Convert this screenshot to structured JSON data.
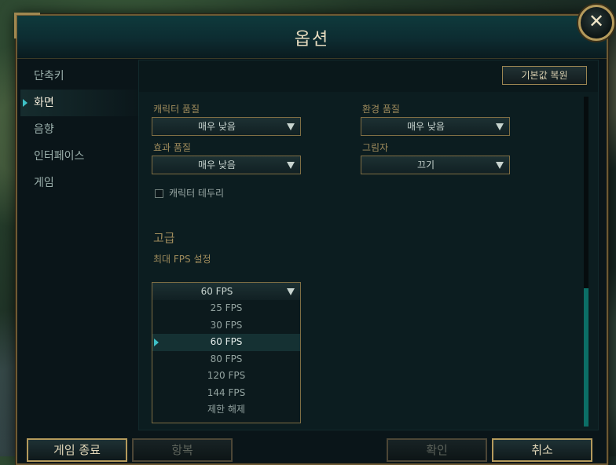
{
  "window": {
    "title": "옵션"
  },
  "sidebar": {
    "items": [
      {
        "label": "단축키",
        "active": false
      },
      {
        "label": "화면",
        "active": true
      },
      {
        "label": "음향",
        "active": false
      },
      {
        "label": "인터페이스",
        "active": false
      },
      {
        "label": "게임",
        "active": false
      }
    ]
  },
  "toolbar": {
    "reset_label": "기본값 복원"
  },
  "graphics": {
    "character_quality": {
      "label": "캐릭터 품질",
      "value": "매우 낮음"
    },
    "environment_quality": {
      "label": "환경 품질",
      "value": "매우 낮음"
    },
    "effects_quality": {
      "label": "효과 품질",
      "value": "매우 낮음"
    },
    "shadows": {
      "label": "그림자",
      "value": "끄기"
    },
    "character_outline": {
      "label": "캐릭터 테두리",
      "checked": false
    }
  },
  "advanced": {
    "title": "고급",
    "fps_label": "최대 FPS 설정",
    "fps_value": "60 FPS",
    "fps_options": [
      "25 FPS",
      "30 FPS",
      "60 FPS",
      "80 FPS",
      "120 FPS",
      "144 FPS",
      "제한 해제"
    ],
    "fps_selected_index": 2
  },
  "footer": {
    "exit_label": "게임 종료",
    "surrender_label": "항복",
    "ok_label": "확인",
    "cancel_label": "취소"
  },
  "colors": {
    "accent_gold": "#b49a5c",
    "accent_teal": "#3ec1c6",
    "label_gold": "#a08c5c"
  }
}
